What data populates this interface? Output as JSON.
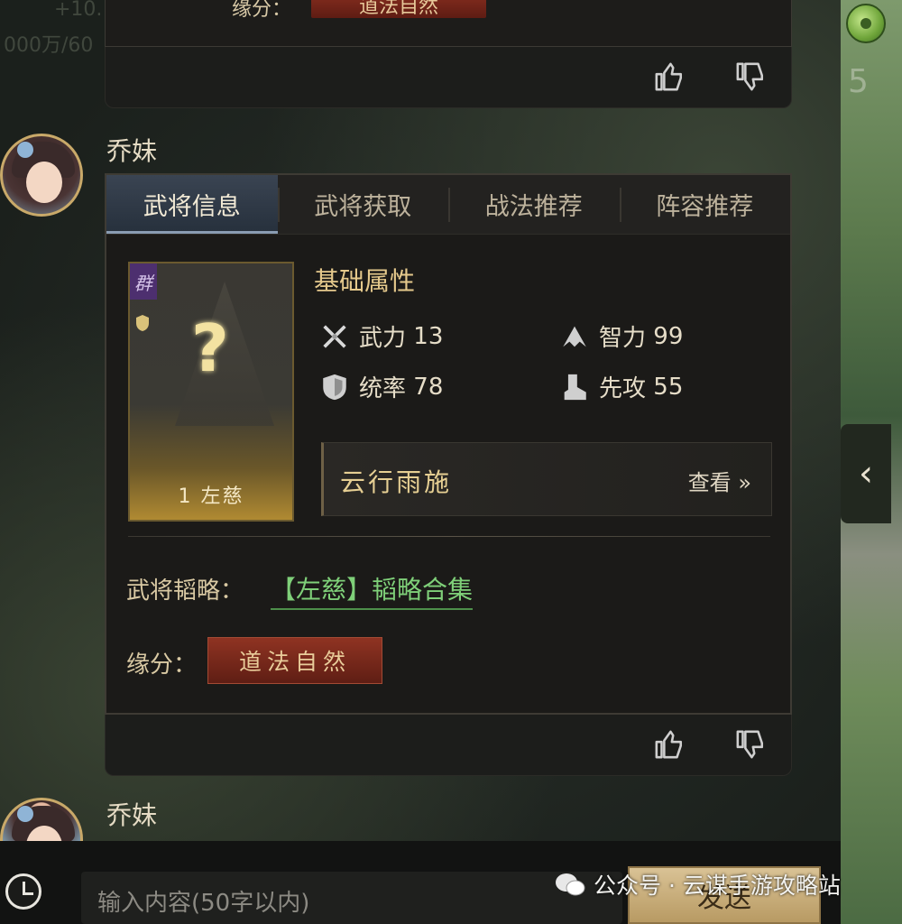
{
  "top_message": {
    "partial_label": "缘分：",
    "partial_tag": "道法自然",
    "partial_stats": "+10.",
    "partial_stats2": "000万/60"
  },
  "message": {
    "sender": "乔妹",
    "tabs": [
      "武将信息",
      "武将获取",
      "战法推荐",
      "阵容推荐"
    ],
    "active_tab": 0,
    "hero": {
      "faction": "群",
      "name": "1 左慈"
    },
    "attributes_title": "基础属性",
    "stats": [
      {
        "icon": "sword-icon",
        "label": "武力",
        "value": "13"
      },
      {
        "icon": "intellect-icon",
        "label": "智力",
        "value": "99"
      },
      {
        "icon": "shield-icon",
        "label": "统率",
        "value": "78"
      },
      {
        "icon": "boot-icon",
        "label": "先攻",
        "value": "55"
      }
    ],
    "skill": {
      "name": "云行雨施",
      "view_label": "查看 »"
    },
    "strategy_label": "武将韬略：",
    "strategy_link": "【左慈】韬略合集",
    "fate_label": "缘分：",
    "fate_tag": "道法自然"
  },
  "next_message": {
    "sender": "乔妹"
  },
  "input": {
    "placeholder": "输入内容(50字以内)",
    "send_label": "发送"
  },
  "watermark": "公众号 · 云谋手游攻略站",
  "map": {
    "number": "5"
  },
  "side_tab_glyph": "‹"
}
